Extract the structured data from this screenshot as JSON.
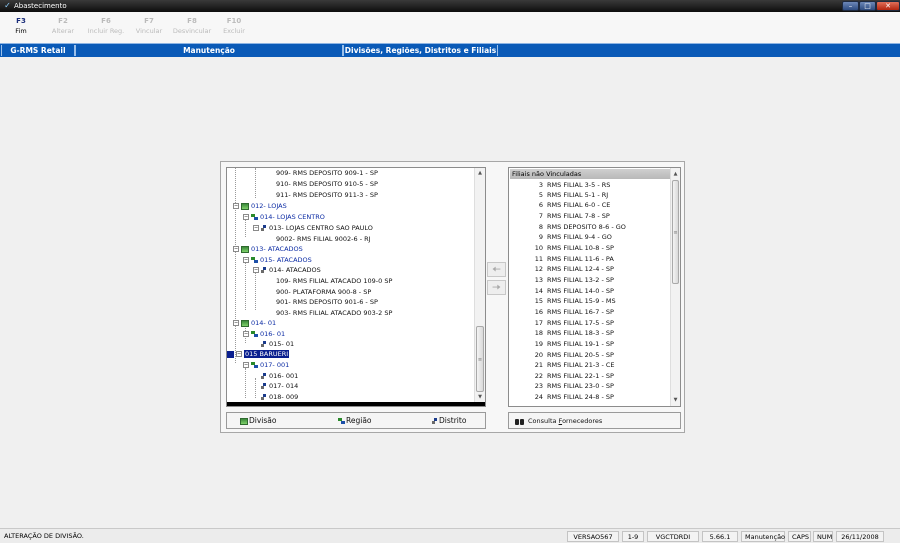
{
  "window": {
    "title": "Abastecimento",
    "minimize_glyph": "–",
    "maximize_glyph": "□",
    "close_glyph": "✕"
  },
  "toolbar": [
    {
      "key": "F3",
      "label": "Fim",
      "enabled": true
    },
    {
      "key": "F2",
      "label": "Alterar",
      "enabled": false
    },
    {
      "key": "F6",
      "label": "Incluir Reg.",
      "enabled": false
    },
    {
      "key": "F7",
      "label": "Vincular",
      "enabled": false
    },
    {
      "key": "F8",
      "label": "Desvincular",
      "enabled": false
    },
    {
      "key": "F10",
      "label": "Excluir",
      "enabled": false
    }
  ],
  "header": {
    "module": "G-RMS Retail",
    "area": "Manutenção",
    "screen": "Divisões, Regiões, Distritos e Filiais"
  },
  "tree": {
    "nodes": [
      {
        "label": "909- RMS DEPOSITO 909-1 - SP",
        "level": 4
      },
      {
        "label": "910- RMS DEPOSITO 910-5 - SP",
        "level": 4
      },
      {
        "label": "911- RMS DEPOSITO 911-3 - SP",
        "level": 4
      },
      {
        "label": "012- LOJAS",
        "level": 1
      },
      {
        "label": "014- LOJAS CENTRO",
        "level": 2
      },
      {
        "label": "013- LOJAS CENTRO SAO PAULO",
        "level": 3
      },
      {
        "label": "9002- RMS FILIAL 9002-6 - RJ",
        "level": 4
      },
      {
        "label": "013- ATACADOS",
        "level": 1
      },
      {
        "label": "015- ATACADOS",
        "level": 2
      },
      {
        "label": "014- ATACADOS",
        "level": 3
      },
      {
        "label": "109- RMS FILIAL ATACADO 109-0 SP",
        "level": 4
      },
      {
        "label": "900- PLATAFORMA 900-8 - SP",
        "level": 4
      },
      {
        "label": "901- RMS DEPOSITO 901-6 - SP",
        "level": 4
      },
      {
        "label": "903- RMS FILIAL ATACADO 903-2 SP",
        "level": 4
      },
      {
        "label": "014- 01",
        "level": 1
      },
      {
        "label": "016- 01",
        "level": 2
      },
      {
        "label": "015- 01",
        "level": 3
      },
      {
        "label": "015 BARUERI",
        "level": 1,
        "selected": true
      },
      {
        "label": "017- 001",
        "level": 2
      },
      {
        "label": "016- 001",
        "level": 3
      },
      {
        "label": "017- 014",
        "level": 3
      },
      {
        "label": "018- 009",
        "level": 3
      }
    ]
  },
  "list": {
    "header": "Filiais não Vinculadas",
    "rows": [
      {
        "num": "3",
        "name": "RMS FILIAL 3-5 - RS"
      },
      {
        "num": "5",
        "name": "RMS FILIAL 5-1 - RJ"
      },
      {
        "num": "6",
        "name": "RMS FILIAL 6-0 - CE"
      },
      {
        "num": "7",
        "name": "RMS FILIAL 7-8 - SP"
      },
      {
        "num": "8",
        "name": "RMS DEPOSITO 8-6 - GO"
      },
      {
        "num": "9",
        "name": "RMS FILIAL 9-4 - GO"
      },
      {
        "num": "10",
        "name": "RMS FILIAL 10-8 - SP"
      },
      {
        "num": "11",
        "name": "RMS FILIAL 11-6 - PA"
      },
      {
        "num": "12",
        "name": "RMS FILIAL 12-4 - SP"
      },
      {
        "num": "13",
        "name": "RMS FILIAL 13-2 - SP"
      },
      {
        "num": "14",
        "name": "RMS FILIAL 14-0 - SP"
      },
      {
        "num": "15",
        "name": "RMS FILIAL 15-9 - MS"
      },
      {
        "num": "16",
        "name": "RMS FILIAL 16-7 - SP"
      },
      {
        "num": "17",
        "name": "RMS FILIAL 17-5 - SP"
      },
      {
        "num": "18",
        "name": "RMS FILIAL 18-3 - SP"
      },
      {
        "num": "19",
        "name": "RMS FILIAL 19-1 - SP"
      },
      {
        "num": "20",
        "name": "RMS FILIAL 20-5 - SP"
      },
      {
        "num": "21",
        "name": "RMS FILIAL 21-3 - CE"
      },
      {
        "num": "22",
        "name": "RMS FILIAL 22-1 - SP"
      },
      {
        "num": "23",
        "name": "RMS FILIAL 23-0 - SP"
      },
      {
        "num": "24",
        "name": "RMS FILIAL 24-8 - SP"
      }
    ]
  },
  "legend": {
    "division": "Divisão",
    "region": "Região",
    "district": "Distrito"
  },
  "consult": {
    "pre": "Consulta ",
    "hot": "F",
    "post": "ornecedores"
  },
  "status": {
    "message": "ALTERAÇÃO DE DIVISÃO.",
    "version": "VERSAO567",
    "page": "1-9",
    "program": "VGCTDRDI",
    "release": "5.66.1",
    "mode": "Manutenção",
    "caps": "CAPS",
    "num": "NUM",
    "date": "26/11/2008"
  },
  "icons": {
    "scroll_up": "scroll-up-arrow-icon",
    "scroll_down": "scroll-down-arrow-icon",
    "transfer_left": "arrow-left-icon",
    "transfer_right": "arrow-right-icon"
  },
  "colors": {
    "header_bar": "#0a5ab7",
    "tree_text": "#0a2aa3",
    "selection": "#0a1f8f"
  }
}
